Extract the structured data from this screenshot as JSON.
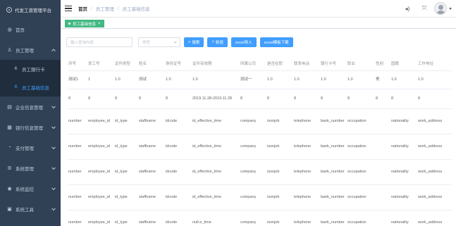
{
  "sidebar": {
    "brand": "代发工资管理平台",
    "items": [
      {
        "label": "首页",
        "icon": "dashboard-icon"
      },
      {
        "label": "员工管理",
        "icon": "user-icon",
        "open": true,
        "children": [
          {
            "label": "员工銀行卡",
            "icon": "bank-card-icon"
          },
          {
            "label": "员工基础信息",
            "icon": "person-icon",
            "active": true
          }
        ]
      },
      {
        "label": "企业信息管理",
        "icon": "company-icon"
      },
      {
        "label": "银行信息管理",
        "icon": "bank-icon"
      },
      {
        "label": "支付管理",
        "icon": "payment-icon"
      },
      {
        "label": "系统管理",
        "icon": "gear-icon"
      },
      {
        "label": "系统监控",
        "icon": "monitor-icon"
      },
      {
        "label": "系统工具",
        "icon": "tool-icon"
      }
    ]
  },
  "header": {
    "breadcrumb": [
      "首页",
      "员工管理",
      "员工基础信息"
    ]
  },
  "tags": [
    {
      "label": "员工基础信息",
      "color": "#42b983"
    }
  ],
  "toolbar": {
    "search_placeholder": "输入查询内容",
    "type_placeholder": "类型",
    "search_btn": "搜索",
    "add_btn": "新增",
    "import_btn": "excel导入",
    "template_btn": "excel模板下载",
    "button_color": "#409eff"
  },
  "table": {
    "columns": [
      "序号",
      "员工号",
      "证件类型",
      "姓名",
      "身份证号",
      "证件有效期",
      "所属公司",
      "是否在职",
      "联系电话",
      "银行卡号",
      "职业",
      "性别",
      "国籍",
      "工作地址"
    ],
    "rows": [
      [
        "测试1",
        "1",
        "1.0",
        "测试",
        "1.0",
        "1.0",
        "测试一",
        "1.0",
        "1.0",
        "1.0",
        "1.0",
        "男",
        "1.0",
        "1.0"
      ],
      [
        "8",
        "8",
        "8",
        "8",
        "8",
        "2019.11.28-2019.11.28",
        "8",
        "8",
        "8",
        "8",
        "8",
        "8",
        "8",
        "8"
      ],
      [
        "number",
        "employee_id",
        "id_type",
        "staffname",
        "idcode",
        "id_effective_time",
        "company",
        "isonjob",
        "telephone",
        "bank_number",
        "occupation",
        "",
        "nationality",
        "work_address"
      ],
      [
        "number",
        "employee_id",
        "id_type",
        "staffname",
        "idcode",
        "id_effective_time",
        "company",
        "isonjob",
        "telephone",
        "bank_number",
        "occupation",
        "",
        "nationality",
        "work_address"
      ],
      [
        "number",
        "employee_id",
        "id_type",
        "staffname",
        "idcode",
        "id_effective_time",
        "company",
        "isonjob",
        "telephone",
        "bank_number",
        "occupation",
        "",
        "nationality",
        "work_address"
      ],
      [
        "number",
        "employee_id",
        "id_type",
        "staffname",
        "idcode",
        "id_effective_time",
        "company",
        "isonjob",
        "telephone",
        "bank_number",
        "occupation",
        "",
        "nationality",
        "work_address"
      ],
      [
        "number",
        "employee_id",
        "id_type",
        "staffname",
        "idcode",
        "null-e_time",
        "company",
        "isonjob",
        "telephone",
        "bank_number",
        "occupation",
        "",
        "nationality",
        "work_address"
      ]
    ]
  },
  "theme": {
    "sidebar_bg": "#304156",
    "submenu_bg": "#1f2d3d",
    "active_color": "#409eff"
  }
}
